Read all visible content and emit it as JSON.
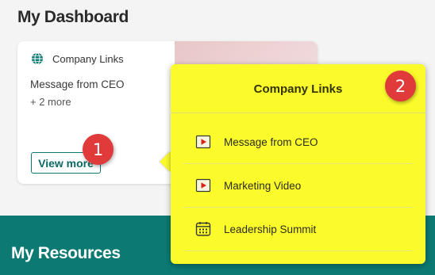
{
  "page": {
    "title": "My Dashboard"
  },
  "card": {
    "header": "Company Links",
    "header_icon": "globe-icon",
    "first_link": "Message from CEO",
    "more_text": "+ 2 more",
    "view_more_label": "View more"
  },
  "popup": {
    "title": "Company Links",
    "items": [
      {
        "label": "Message from CEO",
        "icon": "video-play-icon"
      },
      {
        "label": "Marketing Video",
        "icon": "video-play-icon"
      },
      {
        "label": "Leadership Summit",
        "icon": "calendar-icon"
      }
    ]
  },
  "annotations": {
    "badge_1": "1",
    "badge_2": "2"
  },
  "resources": {
    "title": "My Resources"
  },
  "colors": {
    "accent_teal": "#0c7a73",
    "popup_yellow": "#fbfb2c",
    "badge_red": "#e03a3a",
    "play_red": "#d9261c"
  }
}
